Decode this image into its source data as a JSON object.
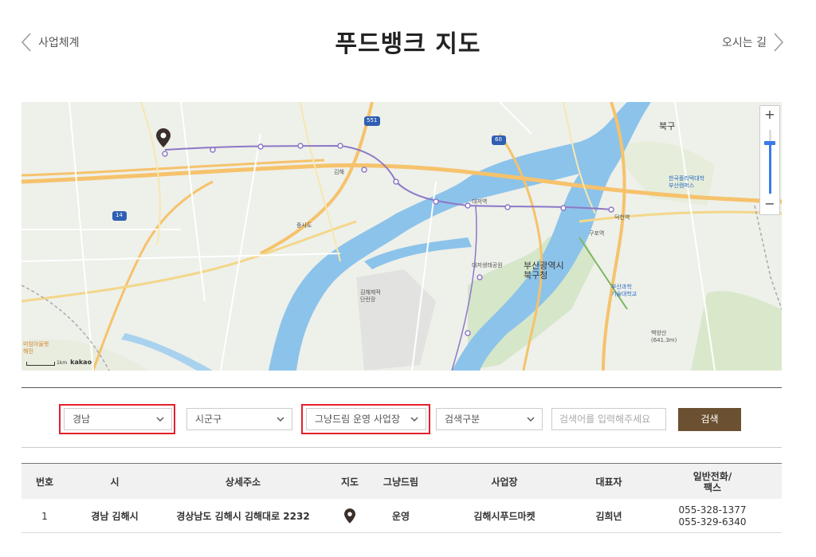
{
  "header": {
    "prev_label": "사업체계",
    "title": "푸드뱅크 지도",
    "next_label": "오시는 길"
  },
  "map": {
    "labels": {
      "north": "북구",
      "busan": "부산광역시\n북구청",
      "nakdong": "대저생태공원",
      "gimhae_ecology": "김해제적\n단란장",
      "univ": "한국폴리텍대학\n부산캠퍼스",
      "sci": "부산과학\n기술대학교",
      "mountain": "백양산\n(641.3m)",
      "river_island": "중사도",
      "bridge": "대저역",
      "gimhae": "김해",
      "deokcheon": "덕천역",
      "gupo": "구포역",
      "museum": "미임아울렛\n해진"
    },
    "road_badges": [
      "551",
      "14",
      "60"
    ],
    "zoom_in": "+",
    "zoom_out": "−",
    "scale_text": "1km",
    "attribution": "kakao",
    "zoom_level": 0.2
  },
  "search": {
    "province": "경남",
    "city": "시군구",
    "operation": "그냥드림 운영 사업장",
    "type": "검색구분",
    "placeholder": "검색어를 입력해주세요",
    "button": "검색"
  },
  "table": {
    "headers": [
      "번호",
      "시",
      "상세주소",
      "지도",
      "그냥드림",
      "사업장",
      "대표자",
      "일반전화/\n팩스"
    ],
    "rows": [
      {
        "no": "1",
        "city": "경남 김해시",
        "address": "경상남도 김해시 김해대로 2232",
        "dream": "운영",
        "site": "김해시푸드마켓",
        "rep": "김희년",
        "phone": "055-328-1377",
        "fax": "055-329-6340"
      }
    ]
  },
  "colors": {
    "button": "#6b5131",
    "highlight": "#e3202b",
    "river": "#8cc3ea",
    "road_major": "#f6c26b",
    "road_minor": "#f3d78a",
    "park": "#cfe3c0"
  }
}
